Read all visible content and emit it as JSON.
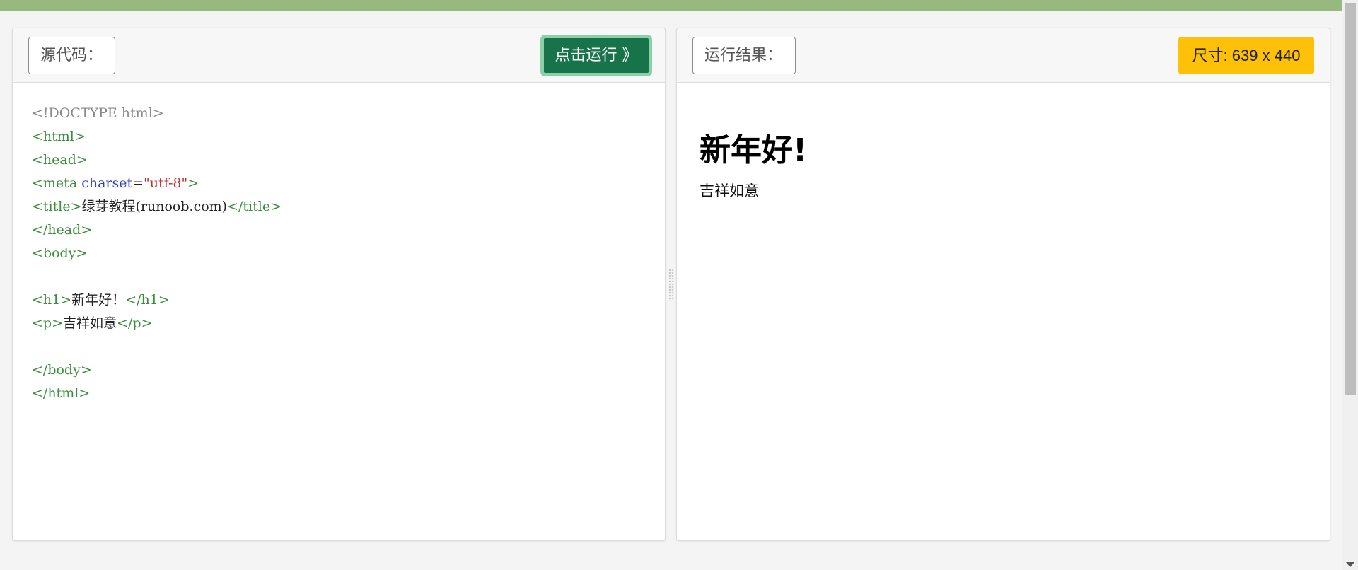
{
  "source_panel": {
    "label": "源代码：",
    "run_button": "点击运行 》",
    "code_lines": [
      [
        {
          "t": "doctype",
          "v": "<!DOCTYPE html>"
        }
      ],
      [
        {
          "t": "tag",
          "v": "<html>"
        }
      ],
      [
        {
          "t": "tag",
          "v": "<head>"
        }
      ],
      [
        {
          "t": "tag",
          "v": "<meta "
        },
        {
          "t": "attr",
          "v": "charset"
        },
        {
          "t": "txt",
          "v": "="
        },
        {
          "t": "str",
          "v": "\"utf-8\""
        },
        {
          "t": "tag",
          "v": ">"
        }
      ],
      [
        {
          "t": "tag",
          "v": "<title>"
        },
        {
          "t": "txt",
          "v": "绿芽教程(runoob.com)"
        },
        {
          "t": "tag",
          "v": "</title>"
        }
      ],
      [
        {
          "t": "tag",
          "v": "</head>"
        }
      ],
      [
        {
          "t": "tag",
          "v": "<body>"
        }
      ],
      [],
      [
        {
          "t": "tag",
          "v": "<h1>"
        },
        {
          "t": "txt",
          "v": "新年好！"
        },
        {
          "t": "tag",
          "v": "</h1>"
        }
      ],
      [
        {
          "t": "tag",
          "v": "<p>"
        },
        {
          "t": "txt",
          "v": "吉祥如意"
        },
        {
          "t": "tag",
          "v": "</p>"
        }
      ],
      [],
      [
        {
          "t": "tag",
          "v": "</body>"
        }
      ],
      [
        {
          "t": "tag",
          "v": "</html>"
        }
      ]
    ]
  },
  "result_panel": {
    "label": "运行结果：",
    "size_badge": "尺寸: 639 x 440",
    "heading": "新年好!",
    "paragraph": "吉祥如意"
  },
  "colors": {
    "top_bar": "#96b97f",
    "run_button": "#17744a",
    "size_badge": "#ffc107",
    "tag": "#3a8e3a",
    "attr": "#3344bb",
    "string": "#b83232"
  }
}
